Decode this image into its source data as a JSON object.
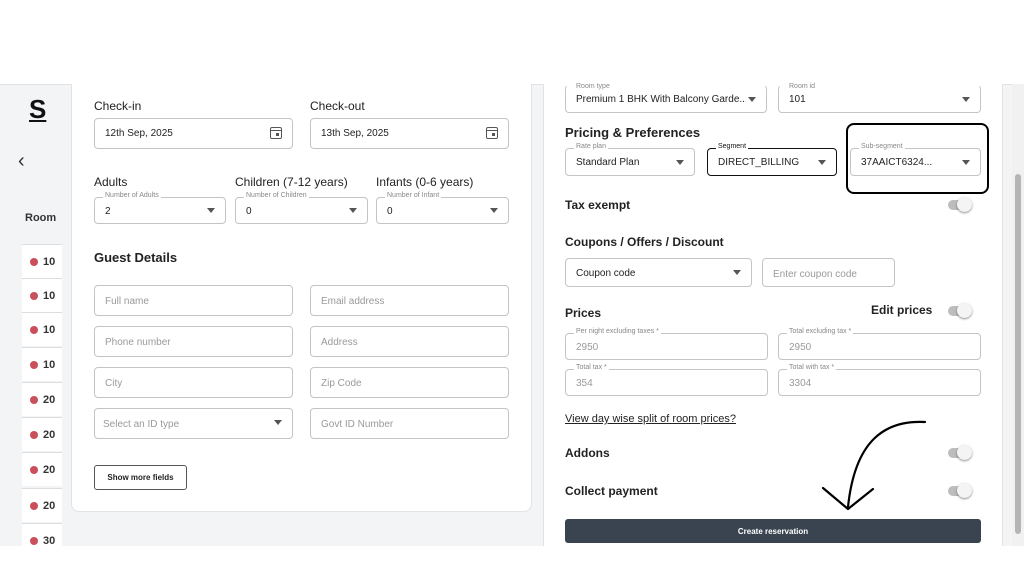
{
  "background_app": {
    "logo": "S",
    "column_header": "Room",
    "rows": [
      "10",
      "10",
      "10",
      "10",
      "20",
      "20",
      "20",
      "20",
      "30"
    ]
  },
  "stay": {
    "checkin_label": "Check-in",
    "checkin_value": "12th Sep, 2025",
    "checkout_label": "Check-out",
    "checkout_value": "13th Sep, 2025",
    "adults_label": "Adults",
    "adults_float": "Number of Adults",
    "adults_value": "2",
    "children_label": "Children (7-12 years)",
    "children_float": "Number of Children",
    "children_value": "0",
    "infants_label": "Infants (0-6 years)",
    "infants_float": "Number of Infant",
    "infants_value": "0"
  },
  "guest": {
    "heading": "Guest Details",
    "full_name_ph": "Full name",
    "email_ph": "Email address",
    "phone_ph": "Phone number",
    "address_ph": "Address",
    "city_ph": "City",
    "zip_ph": "Zip Code",
    "id_type_ph": "Select an ID type",
    "govt_id_ph": "Govt ID Number",
    "show_more": "Show more fields"
  },
  "room": {
    "room_type_float": "Room type",
    "room_type_value": "Premium 1 BHK With Balcony Garde...",
    "room_id_float": "Room id",
    "room_id_value": "101"
  },
  "pricing": {
    "heading": "Pricing & Preferences",
    "rate_plan_float": "Rate plan",
    "rate_plan_value": "Standard Plan",
    "segment_float": "Segment",
    "segment_value": "DIRECT_BILLING",
    "sub_segment_float": "Sub-segment",
    "sub_segment_value": "37AAICT6324...",
    "tax_exempt_label": "Tax exempt"
  },
  "coupons": {
    "heading": "Coupons / Offers / Discount",
    "coupon_select": "Coupon code",
    "coupon_input_ph": "Enter coupon code"
  },
  "prices": {
    "heading": "Prices",
    "edit_label": "Edit prices",
    "per_night_float": "Per night excluding taxes *",
    "per_night_value": "2950",
    "total_ex_float": "Total excluding tax *",
    "total_ex_value": "2950",
    "total_tax_float": "Total tax *",
    "total_tax_value": "354",
    "total_with_float": "Total with tax *",
    "total_with_value": "3304",
    "split_link": "View day wise split of room prices?"
  },
  "extras": {
    "addons_label": "Addons",
    "collect_label": "Collect payment",
    "create_button": "Create reservation"
  },
  "icons": {
    "calendar": "calendar-icon",
    "caret": "chevron-down-icon",
    "back": "chevron-left-icon"
  }
}
